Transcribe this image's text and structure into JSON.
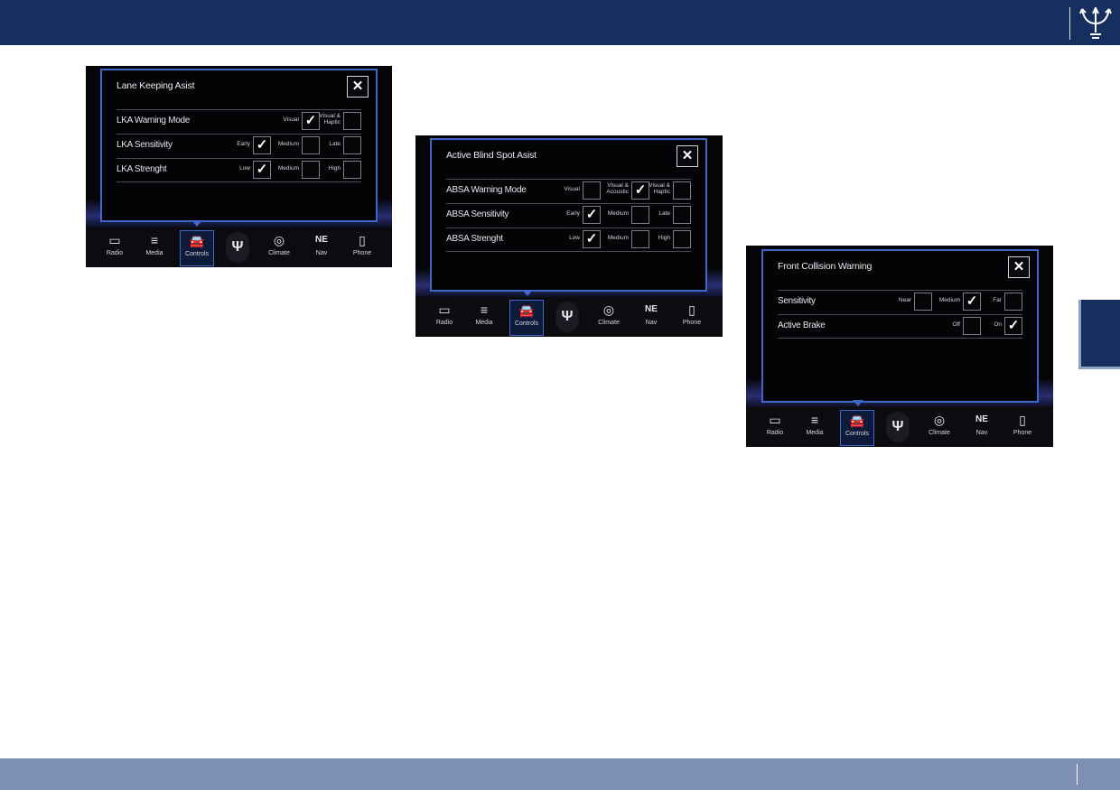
{
  "colors": {
    "header": "#15305e",
    "footer": "#7d8fb5",
    "accent": "#3f67c8"
  },
  "nav": [
    {
      "label": "Radio",
      "icon": "radio-icon"
    },
    {
      "label": "Media",
      "icon": "media-icon"
    },
    {
      "label": "Controls",
      "icon": "car-icon"
    },
    {
      "label": "",
      "icon": "trident-icon"
    },
    {
      "label": "Climate",
      "icon": "climate-icon"
    },
    {
      "label": "Nav",
      "icon": "compass-icon",
      "glyph": "NE"
    },
    {
      "label": "Phone",
      "icon": "phone-icon"
    }
  ],
  "screens": {
    "lka": {
      "title": "Lane Keeping Asist",
      "rows": [
        {
          "label": "LKA Warning Mode",
          "options": [
            {
              "text": "Visual",
              "checked": true
            },
            {
              "text": "Visual & Haptic",
              "checked": false
            }
          ]
        },
        {
          "label": "LKA Sensitivity",
          "options": [
            {
              "text": "Early",
              "checked": true
            },
            {
              "text": "Medium",
              "checked": false
            },
            {
              "text": "Late",
              "checked": false
            }
          ]
        },
        {
          "label": "LKA Strenght",
          "options": [
            {
              "text": "Low",
              "checked": true
            },
            {
              "text": "Medium",
              "checked": false
            },
            {
              "text": "High",
              "checked": false
            }
          ]
        }
      ]
    },
    "absa": {
      "title": "Active Blind Spot Asist",
      "rows": [
        {
          "label": "ABSA Warning Mode",
          "options": [
            {
              "text": "Visual",
              "checked": false
            },
            {
              "text": "Visual & Acoustic",
              "checked": true
            },
            {
              "text": "Visual & Haptic",
              "checked": false
            }
          ]
        },
        {
          "label": "ABSA Sensitivity",
          "options": [
            {
              "text": "Early",
              "checked": true
            },
            {
              "text": "Medium",
              "checked": false
            },
            {
              "text": "Late",
              "checked": false
            }
          ]
        },
        {
          "label": "ABSA Strenght",
          "options": [
            {
              "text": "Low",
              "checked": true
            },
            {
              "text": "Medium",
              "checked": false
            },
            {
              "text": "High",
              "checked": false
            }
          ]
        }
      ]
    },
    "fcw": {
      "title": "Front Collision Warning",
      "rows": [
        {
          "label": "Sensitivity",
          "options": [
            {
              "text": "Near",
              "checked": false
            },
            {
              "text": "Medium",
              "checked": true
            },
            {
              "text": "Far",
              "checked": false
            }
          ]
        },
        {
          "label": "Active Brake",
          "options": [
            {
              "text": "Off",
              "checked": false
            },
            {
              "text": "On",
              "checked": true
            }
          ]
        }
      ]
    }
  }
}
